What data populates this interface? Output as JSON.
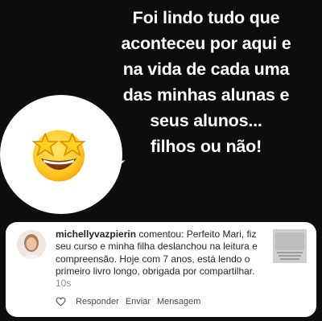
{
  "headline": {
    "lines": [
      "Foi lindo tudo que",
      "aconteceu por aqui e",
      "na vida de cada uma",
      "das minhas alunas e",
      "seus alunos...",
      "filhos ou não!"
    ]
  },
  "sticker": {
    "icon": "star-struck-emoji-icon"
  },
  "comment_card": {
    "username": "michellyvazpierin",
    "verb": "comentou:",
    "text": "Perfeito Mari, fiz seu curso e minha filha deslanchou na leitura e compreensão. Hoje com 7 anos, está lendo o primeiro livro longo, obrigada por compartilhar.",
    "time": "10s",
    "actions": {
      "reply": "Responder",
      "send": "Enviar",
      "message": "Mensagem"
    }
  },
  "colors": {
    "background": "#0d0d0d",
    "card": "#ffffff",
    "text": "#262626",
    "muted": "#8e8e8e"
  }
}
